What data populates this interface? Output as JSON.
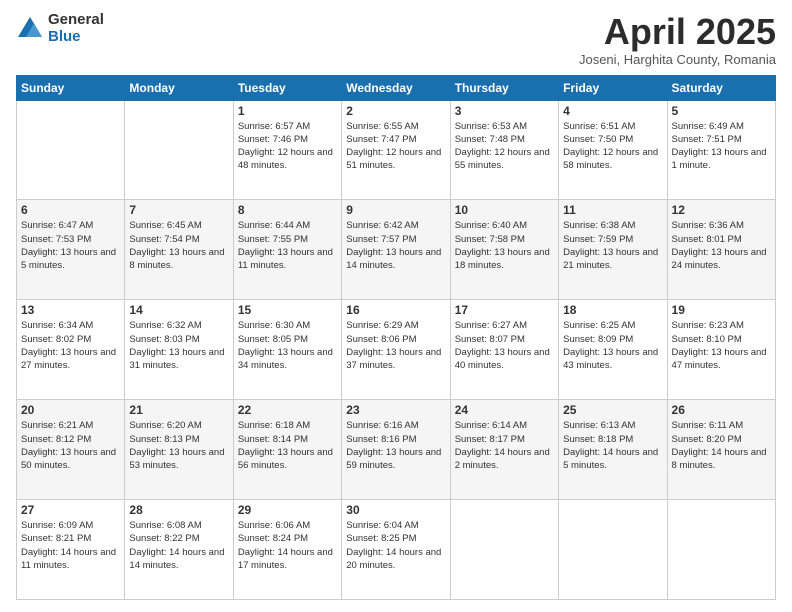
{
  "header": {
    "logo_general": "General",
    "logo_blue": "Blue",
    "title": "April 2025",
    "location": "Joseni, Harghita County, Romania"
  },
  "weekdays": [
    "Sunday",
    "Monday",
    "Tuesday",
    "Wednesday",
    "Thursday",
    "Friday",
    "Saturday"
  ],
  "weeks": [
    [
      {
        "day": "",
        "info": ""
      },
      {
        "day": "",
        "info": ""
      },
      {
        "day": "1",
        "info": "Sunrise: 6:57 AM\nSunset: 7:46 PM\nDaylight: 12 hours and 48 minutes."
      },
      {
        "day": "2",
        "info": "Sunrise: 6:55 AM\nSunset: 7:47 PM\nDaylight: 12 hours and 51 minutes."
      },
      {
        "day": "3",
        "info": "Sunrise: 6:53 AM\nSunset: 7:48 PM\nDaylight: 12 hours and 55 minutes."
      },
      {
        "day": "4",
        "info": "Sunrise: 6:51 AM\nSunset: 7:50 PM\nDaylight: 12 hours and 58 minutes."
      },
      {
        "day": "5",
        "info": "Sunrise: 6:49 AM\nSunset: 7:51 PM\nDaylight: 13 hours and 1 minute."
      }
    ],
    [
      {
        "day": "6",
        "info": "Sunrise: 6:47 AM\nSunset: 7:53 PM\nDaylight: 13 hours and 5 minutes."
      },
      {
        "day": "7",
        "info": "Sunrise: 6:45 AM\nSunset: 7:54 PM\nDaylight: 13 hours and 8 minutes."
      },
      {
        "day": "8",
        "info": "Sunrise: 6:44 AM\nSunset: 7:55 PM\nDaylight: 13 hours and 11 minutes."
      },
      {
        "day": "9",
        "info": "Sunrise: 6:42 AM\nSunset: 7:57 PM\nDaylight: 13 hours and 14 minutes."
      },
      {
        "day": "10",
        "info": "Sunrise: 6:40 AM\nSunset: 7:58 PM\nDaylight: 13 hours and 18 minutes."
      },
      {
        "day": "11",
        "info": "Sunrise: 6:38 AM\nSunset: 7:59 PM\nDaylight: 13 hours and 21 minutes."
      },
      {
        "day": "12",
        "info": "Sunrise: 6:36 AM\nSunset: 8:01 PM\nDaylight: 13 hours and 24 minutes."
      }
    ],
    [
      {
        "day": "13",
        "info": "Sunrise: 6:34 AM\nSunset: 8:02 PM\nDaylight: 13 hours and 27 minutes."
      },
      {
        "day": "14",
        "info": "Sunrise: 6:32 AM\nSunset: 8:03 PM\nDaylight: 13 hours and 31 minutes."
      },
      {
        "day": "15",
        "info": "Sunrise: 6:30 AM\nSunset: 8:05 PM\nDaylight: 13 hours and 34 minutes."
      },
      {
        "day": "16",
        "info": "Sunrise: 6:29 AM\nSunset: 8:06 PM\nDaylight: 13 hours and 37 minutes."
      },
      {
        "day": "17",
        "info": "Sunrise: 6:27 AM\nSunset: 8:07 PM\nDaylight: 13 hours and 40 minutes."
      },
      {
        "day": "18",
        "info": "Sunrise: 6:25 AM\nSunset: 8:09 PM\nDaylight: 13 hours and 43 minutes."
      },
      {
        "day": "19",
        "info": "Sunrise: 6:23 AM\nSunset: 8:10 PM\nDaylight: 13 hours and 47 minutes."
      }
    ],
    [
      {
        "day": "20",
        "info": "Sunrise: 6:21 AM\nSunset: 8:12 PM\nDaylight: 13 hours and 50 minutes."
      },
      {
        "day": "21",
        "info": "Sunrise: 6:20 AM\nSunset: 8:13 PM\nDaylight: 13 hours and 53 minutes."
      },
      {
        "day": "22",
        "info": "Sunrise: 6:18 AM\nSunset: 8:14 PM\nDaylight: 13 hours and 56 minutes."
      },
      {
        "day": "23",
        "info": "Sunrise: 6:16 AM\nSunset: 8:16 PM\nDaylight: 13 hours and 59 minutes."
      },
      {
        "day": "24",
        "info": "Sunrise: 6:14 AM\nSunset: 8:17 PM\nDaylight: 14 hours and 2 minutes."
      },
      {
        "day": "25",
        "info": "Sunrise: 6:13 AM\nSunset: 8:18 PM\nDaylight: 14 hours and 5 minutes."
      },
      {
        "day": "26",
        "info": "Sunrise: 6:11 AM\nSunset: 8:20 PM\nDaylight: 14 hours and 8 minutes."
      }
    ],
    [
      {
        "day": "27",
        "info": "Sunrise: 6:09 AM\nSunset: 8:21 PM\nDaylight: 14 hours and 11 minutes."
      },
      {
        "day": "28",
        "info": "Sunrise: 6:08 AM\nSunset: 8:22 PM\nDaylight: 14 hours and 14 minutes."
      },
      {
        "day": "29",
        "info": "Sunrise: 6:06 AM\nSunset: 8:24 PM\nDaylight: 14 hours and 17 minutes."
      },
      {
        "day": "30",
        "info": "Sunrise: 6:04 AM\nSunset: 8:25 PM\nDaylight: 14 hours and 20 minutes."
      },
      {
        "day": "",
        "info": ""
      },
      {
        "day": "",
        "info": ""
      },
      {
        "day": "",
        "info": ""
      }
    ]
  ]
}
